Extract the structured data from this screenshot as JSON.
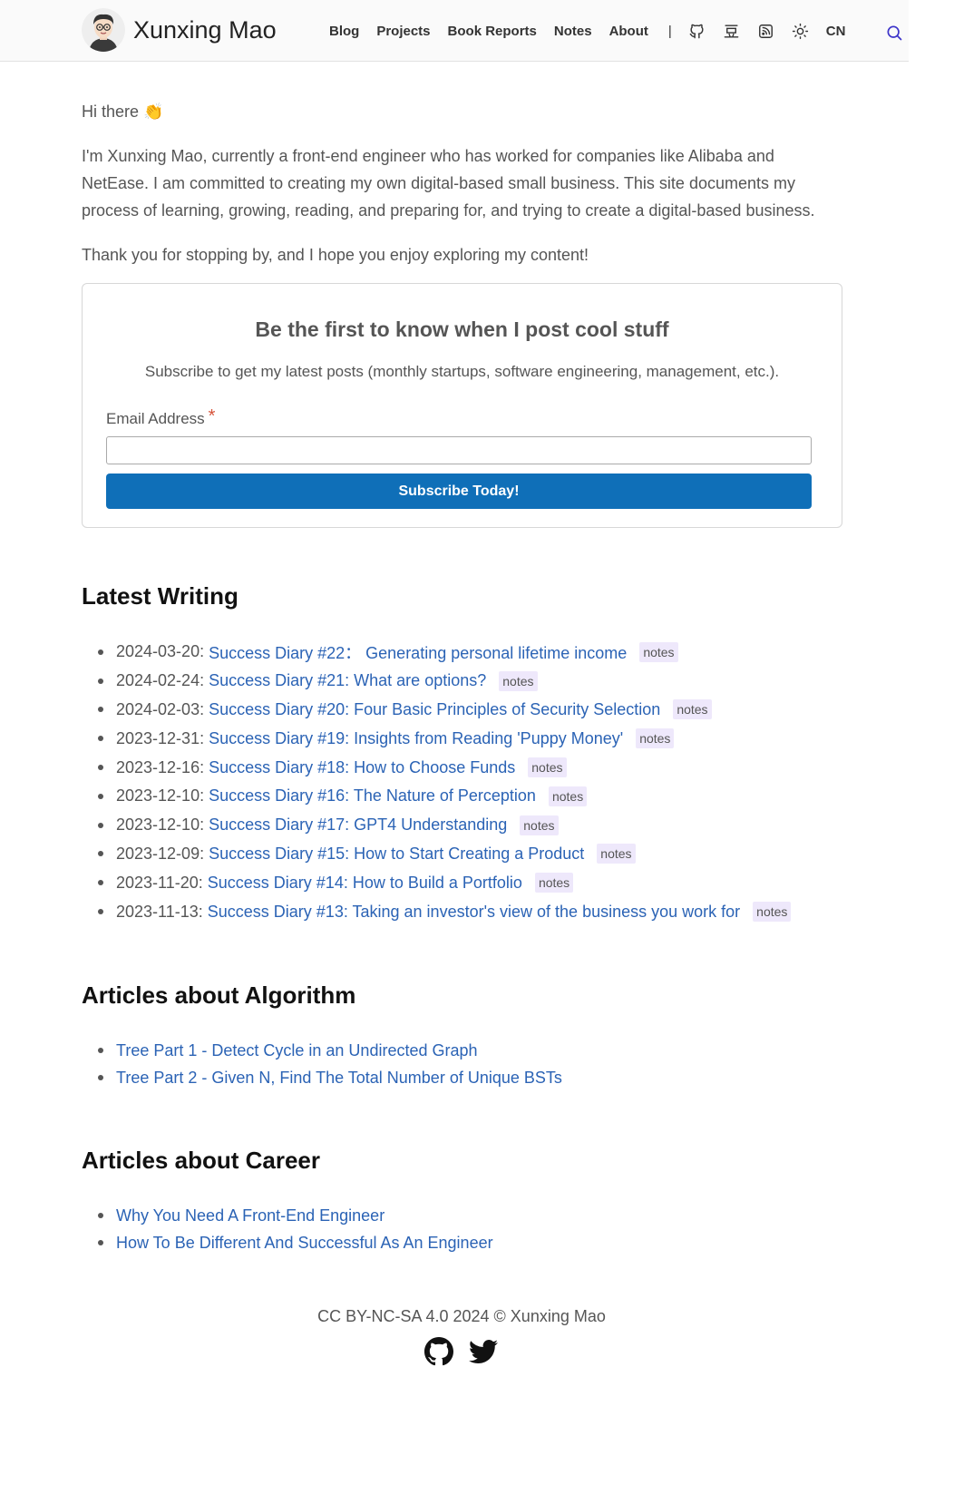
{
  "header": {
    "site_name": "Xunxing Mao",
    "nav": [
      "Blog",
      "Projects",
      "Book Reports",
      "Notes",
      "About"
    ],
    "separator": "|",
    "lang": "CN"
  },
  "intro": {
    "greeting": "Hi there 👏",
    "bio": "I'm Xunxing Mao, currently a front-end engineer who has worked for companies like Alibaba and NetEase. I am committed to creating my own digital-based small business. This site documents my process of learning, growing, reading, and preparing for, and trying to create a digital-based business.",
    "thanks": "Thank you for stopping by, and I hope you enjoy exploring my content!"
  },
  "subscribe": {
    "title": "Be the first to know when I post cool stuff",
    "description": "Subscribe to get my latest posts (monthly startups, software engineering, management, etc.).",
    "email_label": "Email Address",
    "required_mark": "*",
    "email_value": "",
    "button": "Subscribe Today!"
  },
  "latest": {
    "title": "Latest Writing",
    "items": [
      {
        "date": "2024-03-20:",
        "title": "Success Diary #22： Generating personal lifetime income",
        "tag": "notes"
      },
      {
        "date": "2024-02-24:",
        "title": "Success Diary #21: What are options?",
        "tag": "notes"
      },
      {
        "date": "2024-02-03:",
        "title": "Success Diary #20: Four Basic Principles of Security Selection",
        "tag": "notes"
      },
      {
        "date": "2023-12-31:",
        "title": "Success Diary #19: Insights from Reading 'Puppy Money'",
        "tag": "notes"
      },
      {
        "date": "2023-12-16:",
        "title": "Success Diary #18: How to Choose Funds",
        "tag": "notes"
      },
      {
        "date": "2023-12-10:",
        "title": "Success Diary #16: The Nature of Perception",
        "tag": "notes"
      },
      {
        "date": "2023-12-10:",
        "title": "Success Diary #17: GPT4 Understanding",
        "tag": "notes"
      },
      {
        "date": "2023-12-09:",
        "title": "Success Diary #15: How to Start Creating a Product",
        "tag": "notes"
      },
      {
        "date": "2023-11-20:",
        "title": "Success Diary #14: How to Build a Portfolio",
        "tag": "notes"
      },
      {
        "date": "2023-11-13:",
        "title": "Success Diary #13: Taking an investor's view of the business you work for",
        "tag": "notes"
      }
    ]
  },
  "algorithm": {
    "title": "Articles about Algorithm",
    "items": [
      "Tree Part 1 - Detect Cycle in an Undirected Graph",
      "Tree Part 2 - Given N, Find The Total Number of Unique BSTs"
    ]
  },
  "career": {
    "title": "Articles about Career",
    "items": [
      "Why You Need A Front-End Engineer",
      "How To Be Different And Successful As An Engineer"
    ]
  },
  "footer": {
    "text": "CC BY-NC-SA 4.0 2024 © Xunxing Mao"
  }
}
